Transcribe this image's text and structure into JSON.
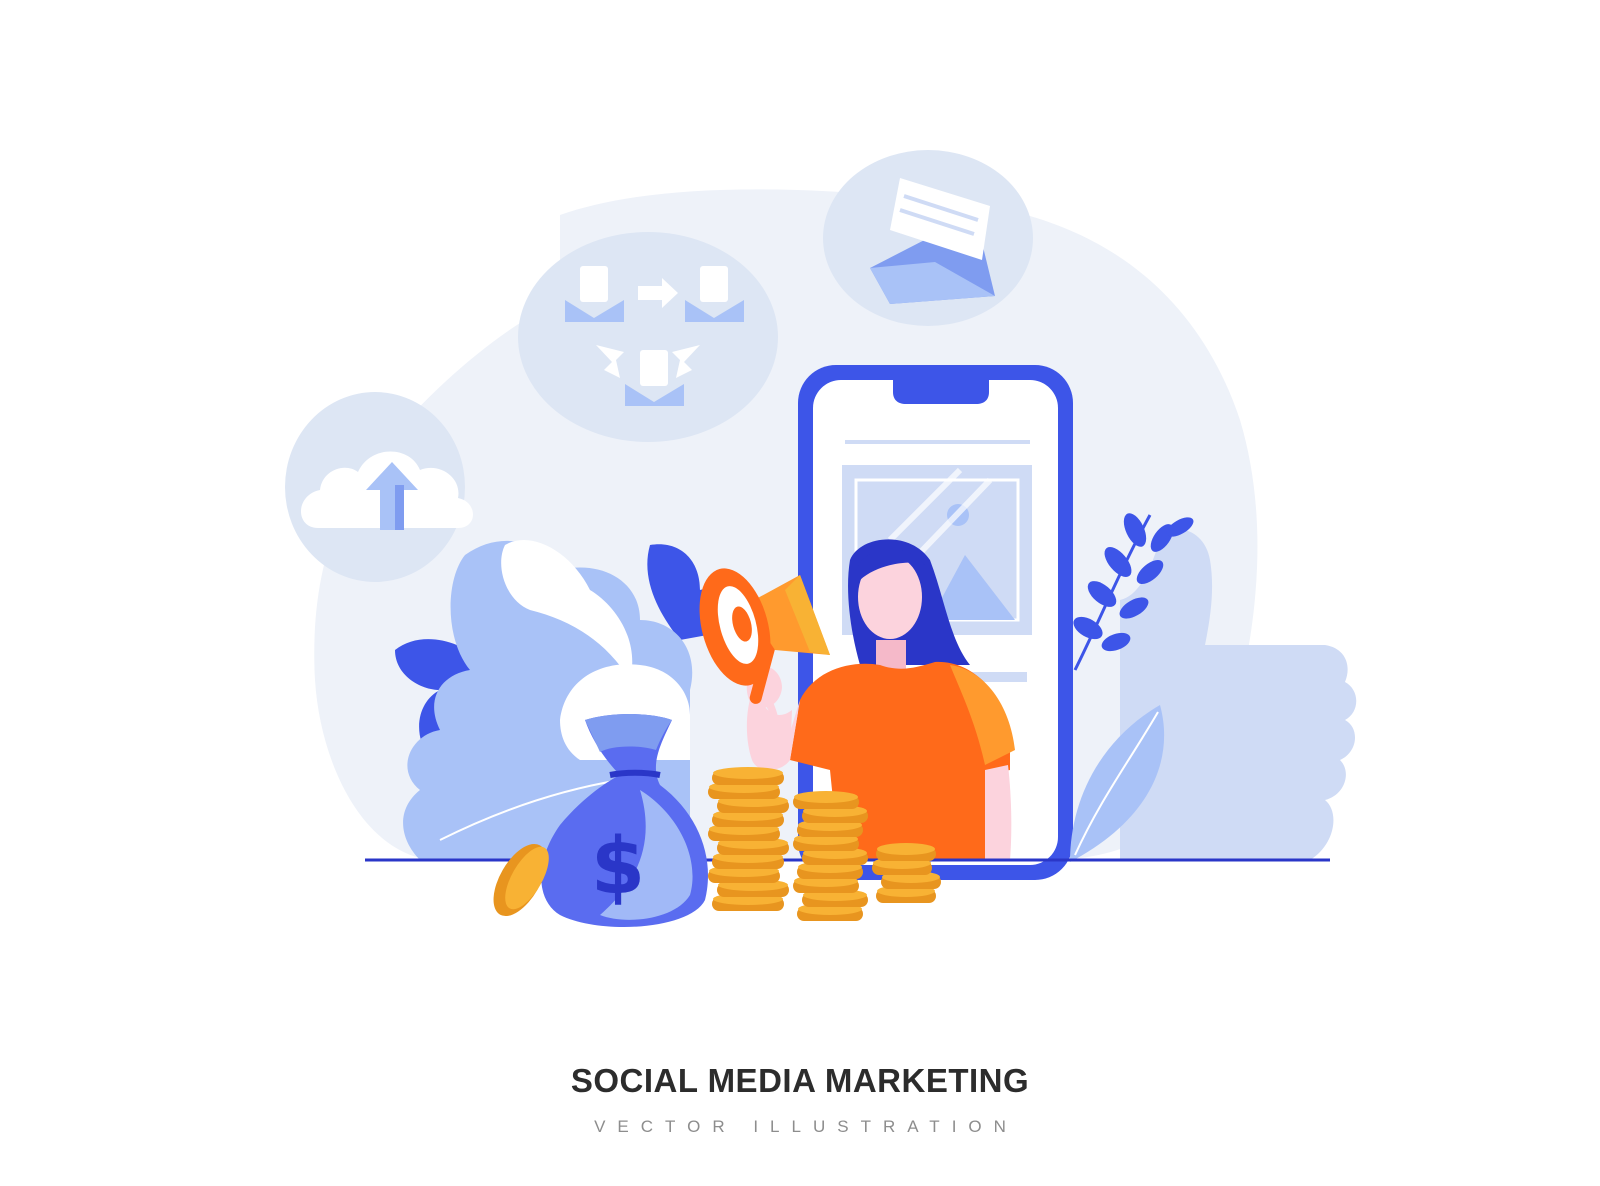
{
  "caption": {
    "title": "SOCIAL MEDIA MARKETING",
    "subtitle": "VECTOR ILLUSTRATION"
  },
  "colors": {
    "background": "#ffffff",
    "blob": "#eef2f9",
    "bubble": "#dde6f4",
    "primary_blue": "#3d55e8",
    "light_blue": "#a9c2f7",
    "pale_blue": "#cfdbf5",
    "orange": "#ff6a1a",
    "orange_light": "#ff9a2e",
    "coin": "#f8b234",
    "coin_dark": "#e8951f",
    "skin": "#fcd3dd",
    "title_text": "#2c2c2c",
    "subtitle_text": "#8d8d8d"
  },
  "icons": [
    "cloud-upload-icon",
    "share-network-icon",
    "envelope-icon",
    "smartphone-icon",
    "image-placeholder-icon",
    "megaphone-icon",
    "money-bag-icon",
    "dollar-sign-icon",
    "coin-stack-icon",
    "thumbs-up-icon",
    "leaf-icon"
  ],
  "scene": {
    "dollar_symbol": "$"
  }
}
